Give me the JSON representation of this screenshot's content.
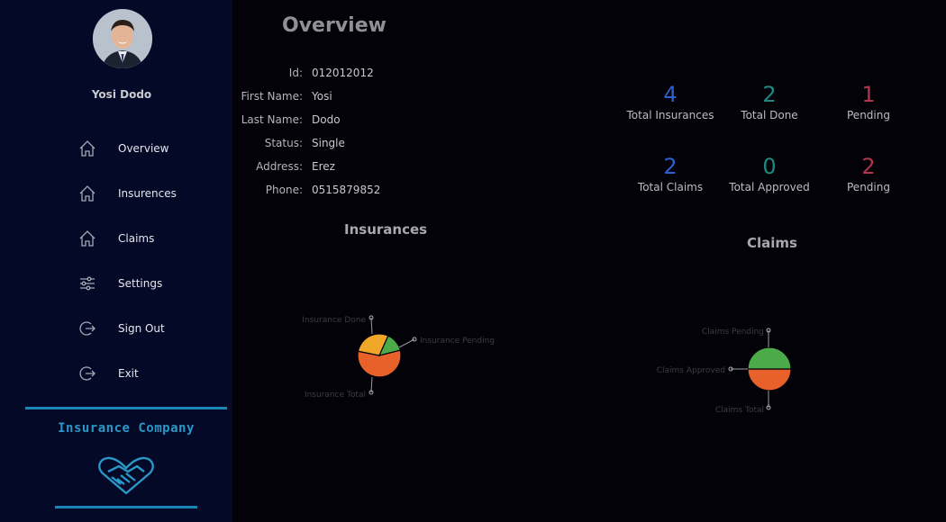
{
  "user": {
    "name": "Yosi Dodo"
  },
  "nav": {
    "items": [
      {
        "label": "Overview",
        "icon": "home-icon"
      },
      {
        "label": "Insurences",
        "icon": "home-icon"
      },
      {
        "label": "Claims",
        "icon": "home-icon"
      },
      {
        "label": "Settings",
        "icon": "sliders-icon"
      },
      {
        "label": "Sign Out",
        "icon": "exit-icon"
      },
      {
        "label": "Exit",
        "icon": "exit-icon"
      }
    ]
  },
  "brand": {
    "title": "Insurance Company",
    "color": "#1a86b6",
    "logo_icon": "handshake-heart-icon"
  },
  "page": {
    "title": "Overview"
  },
  "profile": {
    "fields": [
      {
        "key": "Id:",
        "value": "012012012"
      },
      {
        "key": "First Name:",
        "value": "Yosi"
      },
      {
        "key": "Last Name:",
        "value": "Dodo"
      },
      {
        "key": "Status:",
        "value": "Single"
      },
      {
        "key": "Address:",
        "value": "Erez"
      },
      {
        "key": "Phone:",
        "value": "0515879852"
      }
    ]
  },
  "stats": {
    "insurances": [
      {
        "value": "4",
        "label": "Total Insurances",
        "color": "#2f5fd0"
      },
      {
        "value": "2",
        "label": "Total Done",
        "color": "#1f8a82"
      },
      {
        "value": "1",
        "label": "Pending",
        "color": "#b0364e"
      }
    ],
    "claims": [
      {
        "value": "2",
        "label": "Total Claims",
        "color": "#2f5fd0"
      },
      {
        "value": "0",
        "label": "Total Approved",
        "color": "#1f8a82"
      },
      {
        "value": "2",
        "label": "Pending",
        "color": "#b0364e"
      }
    ]
  },
  "chart_data": [
    {
      "type": "pie",
      "title": "Insurances",
      "labels": [
        "Insurance Total",
        "Insurance Done",
        "Insurance Pending"
      ],
      "values": [
        4,
        2,
        1
      ],
      "colors": [
        "#e8612a",
        "#f0a629",
        "#4caa48"
      ]
    },
    {
      "type": "pie",
      "title": "Claims",
      "labels": [
        "Claims Total",
        "Claims Approved",
        "Claims Pending"
      ],
      "values": [
        2,
        0,
        2
      ],
      "colors": [
        "#e8612a",
        "#f0a629",
        "#4caa48"
      ]
    }
  ]
}
